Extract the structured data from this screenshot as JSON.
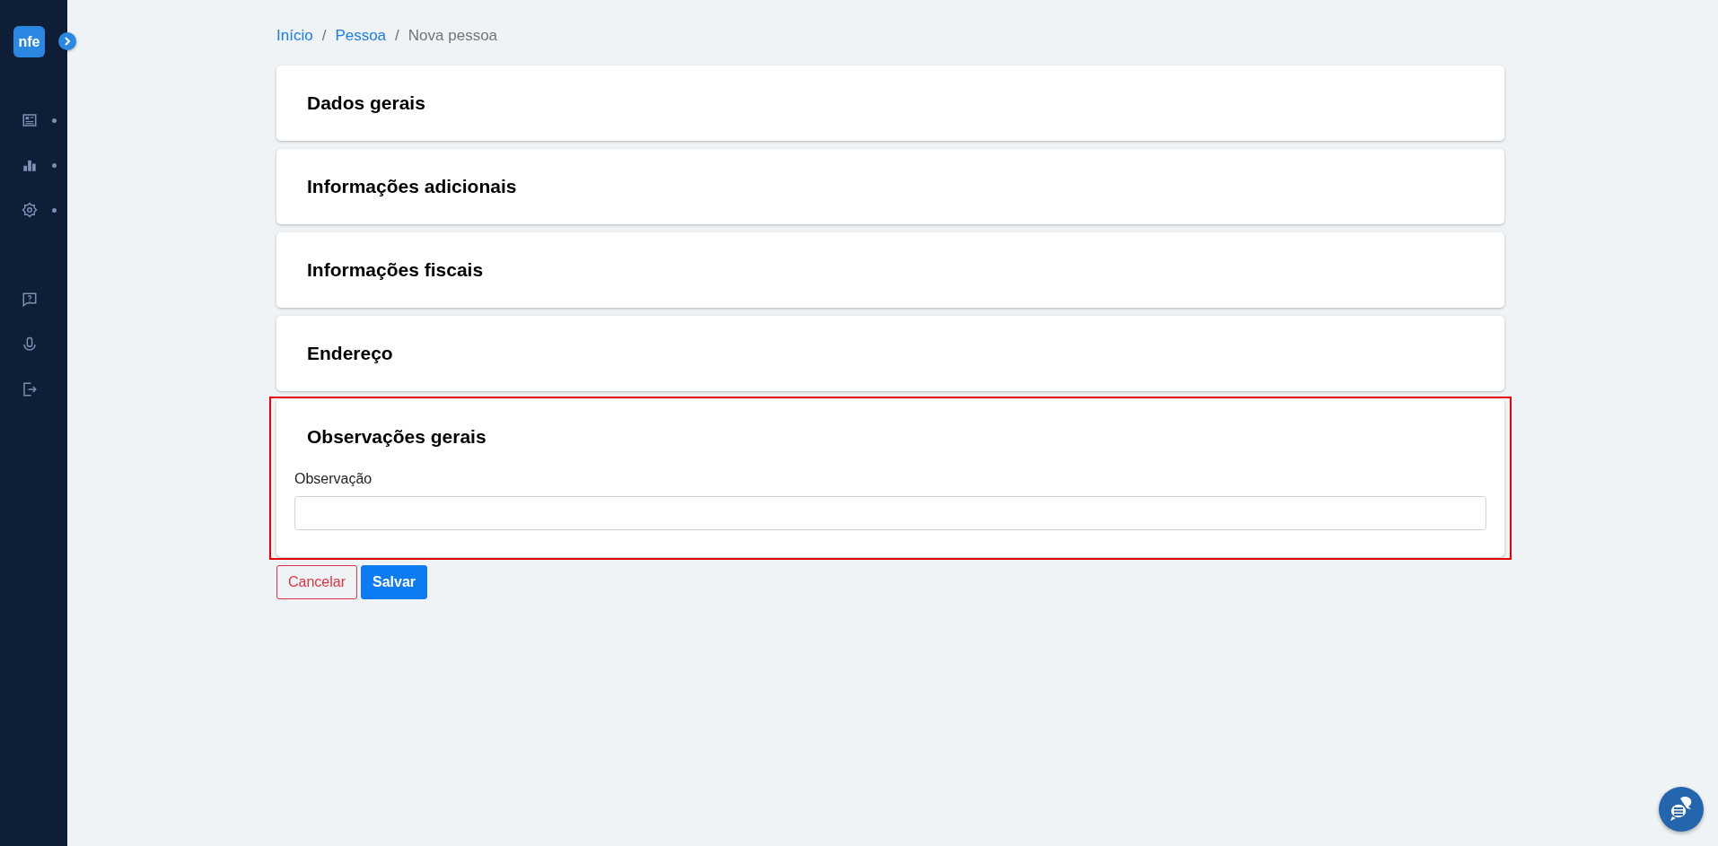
{
  "sidebar": {
    "logo": "nfe",
    "items": [
      {
        "kind": "news",
        "has_submenu": true
      },
      {
        "kind": "chart",
        "has_submenu": true
      },
      {
        "kind": "settings",
        "has_submenu": true
      },
      {
        "kind": "help",
        "has_submenu": false
      },
      {
        "kind": "mic",
        "has_submenu": false
      },
      {
        "kind": "logout",
        "has_submenu": false
      }
    ]
  },
  "breadcrumb": [
    {
      "label": "Início",
      "link": true,
      "separator": "/"
    },
    {
      "label": "Pessoa",
      "link": true,
      "separator": "/"
    },
    {
      "label": "Nova pessoa",
      "link": false
    }
  ],
  "sections": [
    {
      "title": "Dados gerais",
      "highlighted": false
    },
    {
      "title": "Informações adicionais",
      "highlighted": false
    },
    {
      "title": "Informações fiscais",
      "highlighted": false
    },
    {
      "title": "Endereço",
      "highlighted": false
    },
    {
      "title": "Observações gerais",
      "highlighted": true,
      "fields": [
        {
          "label": "Observação"
        }
      ]
    }
  ],
  "buttons": [
    {
      "label": "Cancelar",
      "kind": "secondary"
    },
    {
      "label": "Salvar",
      "kind": "primary"
    }
  ]
}
